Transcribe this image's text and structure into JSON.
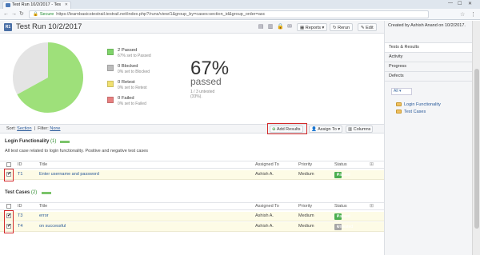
{
  "browser": {
    "tab_title": "Test Run 10/2/2017 - Tes",
    "url_secure": "Secure",
    "url": "https://learnbasicstestrail.testrail.net/index.php?/runs/view/1&group_by=cases:section_id&group_order=asc"
  },
  "header": {
    "badge": "R1",
    "title": "Test Run 10/2/2017",
    "reports_label": "Reports",
    "rerun_label": "Rerun",
    "edit_label": "Edit"
  },
  "sidebar": {
    "created": "Created by Ashish Anand on 10/2/2017.",
    "nav": [
      "Tests & Results",
      "Activity",
      "Progress",
      "Defects"
    ],
    "filter_value": "All",
    "tree": [
      "Login Functionality",
      "Test Cases"
    ]
  },
  "summary": {
    "percent": "67%",
    "passed_word": "passed",
    "untested_note": "1 / 3 untested (33%).",
    "legend": [
      {
        "label": "2 Passed",
        "sub": "67% set to Passed",
        "color": "#7fd46a"
      },
      {
        "label": "0 Blocked",
        "sub": "0% set to Blocked",
        "color": "#bdbdbd"
      },
      {
        "label": "0 Retest",
        "sub": "0% set to Retest",
        "color": "#f0e070"
      },
      {
        "label": "0 Failed",
        "sub": "0% set to Failed",
        "color": "#e88080"
      }
    ],
    "pie": {
      "passed": 67,
      "untested": 33,
      "passed_color": "#9ee07a",
      "untested_color": "#e4e4e4"
    }
  },
  "toolbar": {
    "sort_label": "Sort:",
    "sort_value": "Section",
    "filter_label": "Filter:",
    "filter_value": "None",
    "add_results": "Add Results",
    "assign_to": "Assign To",
    "columns": "Columns"
  },
  "columns": {
    "id": "ID",
    "title": "Title",
    "assigned": "Assigned To",
    "priority": "Priority",
    "status": "Status"
  },
  "sections": [
    {
      "name": "Login Functionality",
      "count": "(1)",
      "description": "All test case related to login functionality. Positive and negative test cases",
      "rows": [
        {
          "id": "T1",
          "title": "Enter username and password",
          "assigned": "Ashish A.",
          "priority": "Medium",
          "status": "Passed",
          "status_color": "#4caf50"
        }
      ]
    },
    {
      "name": "Test Cases",
      "count": "(2)",
      "description": "",
      "rows": [
        {
          "id": "T3",
          "title": "error",
          "assigned": "Ashish A.",
          "priority": "Medium",
          "status": "Passed",
          "status_color": "#4caf50"
        },
        {
          "id": "T4",
          "title": "on successful",
          "assigned": "Ashish A.",
          "priority": "Medium",
          "status": "Untested",
          "status_color": "#a6a6a6"
        }
      ]
    }
  ]
}
